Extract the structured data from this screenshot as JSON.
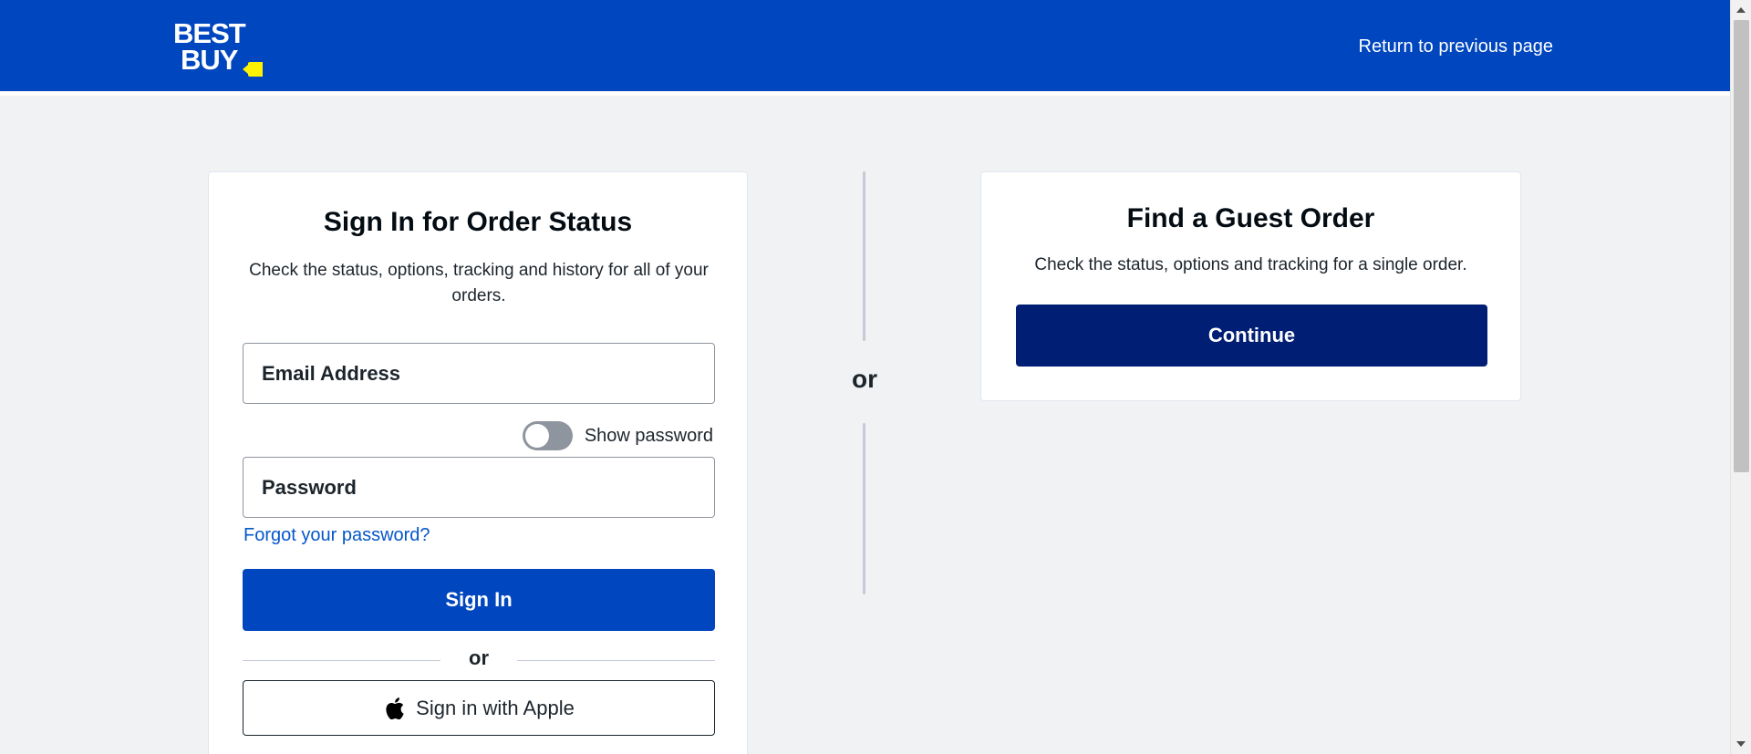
{
  "header": {
    "logo_line1": "BEST",
    "logo_line2": "BUY",
    "return_link": "Return to previous page"
  },
  "signin_card": {
    "title": "Sign In for Order Status",
    "description": "Check the status, options, tracking and history for all of your orders.",
    "email_placeholder": "Email Address",
    "show_password_label": "Show password",
    "show_password_on": false,
    "password_placeholder": "Password",
    "forgot_link": "Forgot your password?",
    "signin_button": "Sign In",
    "or_text": "or",
    "apple_button": "Sign in with Apple"
  },
  "divider": {
    "or_text": "or"
  },
  "guest_card": {
    "title": "Find a Guest Order",
    "description": "Check the status, options and tracking for a single order.",
    "continue_button": "Continue"
  },
  "colors": {
    "brand_blue": "#0046be",
    "dark_blue": "#001e73",
    "brand_yellow": "#fff200",
    "link_blue": "#0457c8"
  }
}
